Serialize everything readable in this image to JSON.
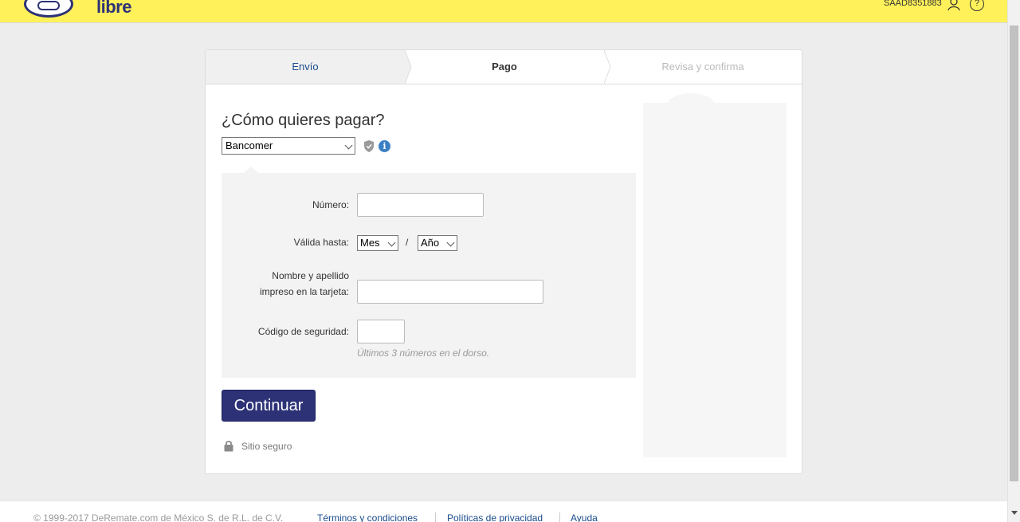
{
  "header": {
    "logo_text": "libre",
    "user_id": "SAAD8351883",
    "help_glyph": "?"
  },
  "steps": [
    {
      "label": "Envío",
      "state": "done"
    },
    {
      "label": "Pago",
      "state": "current"
    },
    {
      "label": "Revisa y confirma",
      "state": "pending"
    }
  ],
  "payment": {
    "title": "¿Cómo quieres pagar?",
    "bank_selected": "Bancomer",
    "info_glyph": "i"
  },
  "form": {
    "number_label": "Número:",
    "number_value": "",
    "valid_label": "Válida hasta:",
    "month_selected": "Mes",
    "separator": "/",
    "year_selected": "Año",
    "name_label_line1": "Nombre y apellido",
    "name_label_line2": "impreso en la tarjeta:",
    "name_value": "",
    "cvv_label": "Código de seguridad:",
    "cvv_value": "",
    "cvv_hint": "Últimos 3 números en el dorso."
  },
  "actions": {
    "continue_label": "Continuar",
    "secure_label": "Sitio seguro"
  },
  "footer": {
    "copyright": "© 1999-2017 DeRemate.com de México S. de R.L. de C.V.",
    "terms": "Términos y condiciones",
    "privacy": "Políticas de privacidad",
    "help": "Ayuda"
  },
  "colors": {
    "header_bg": "#fff159",
    "brand_blue": "#2d3277",
    "link_blue": "#1a4b8c"
  }
}
